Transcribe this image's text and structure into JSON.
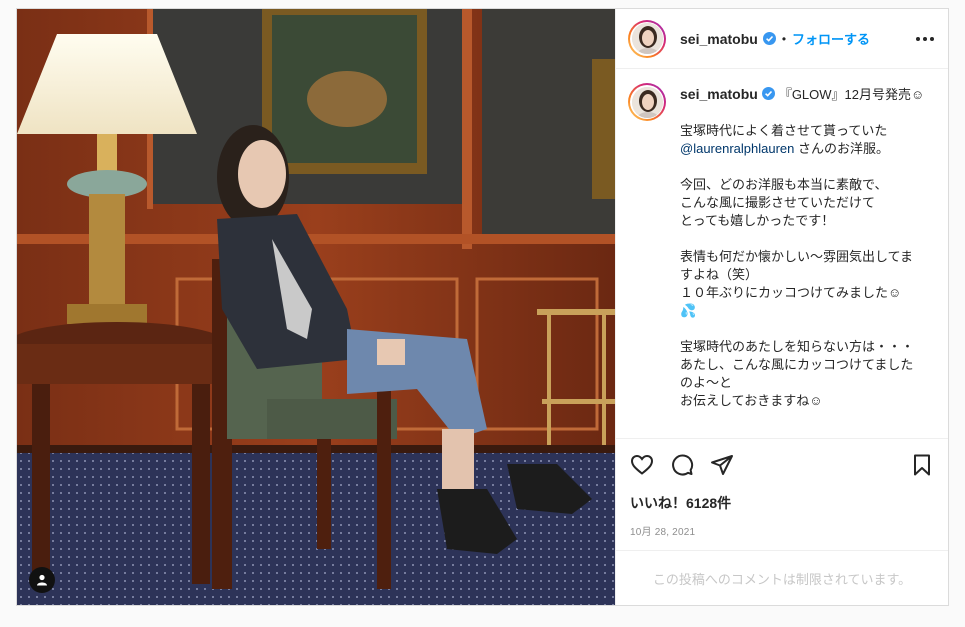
{
  "post": {
    "username": "sei_matobu",
    "follow_label": "フォローする",
    "separator": "•",
    "caption_title": "『GLOW』12月号発売☺",
    "caption_paragraphs": [
      {
        "line1": "宝塚時代によく着させて貰っていた",
        "mention": "@laurenralphlauren",
        "line2": " さんのお洋服。"
      },
      {
        "text": "今回、どのお洋服も本当に素敵で、\nこんな風に撮影させていただけて\nとっても嬉しかったです！"
      },
      {
        "text": "表情も何だか懐かしい〜雰囲気出してま\nすよね（笑）\n１０年ぶりにカッコつけてみました☺\n💦"
      },
      {
        "text": "宝塚時代のあたしを知らない方は・・・\nあたし、こんな風にカッコつけてました\nのよ〜と\nお伝えしておきますね☺"
      }
    ],
    "likes_text": "いいね！6128件",
    "date": "10月 28, 2021",
    "comments_disabled": "この投稿へのコメントは制限されています。"
  },
  "icons": {
    "verified": "verified-badge-icon",
    "more": "more-options-icon",
    "like": "heart-icon",
    "comment": "comment-icon",
    "share": "paper-plane-icon",
    "save": "bookmark-icon",
    "user_tag": "user-tag-icon"
  },
  "colors": {
    "link_blue": "#0095f6",
    "verified_blue": "#3897f0",
    "mention": "#00376b",
    "muted": "#8e8e8e",
    "border": "#dbdbdb"
  }
}
